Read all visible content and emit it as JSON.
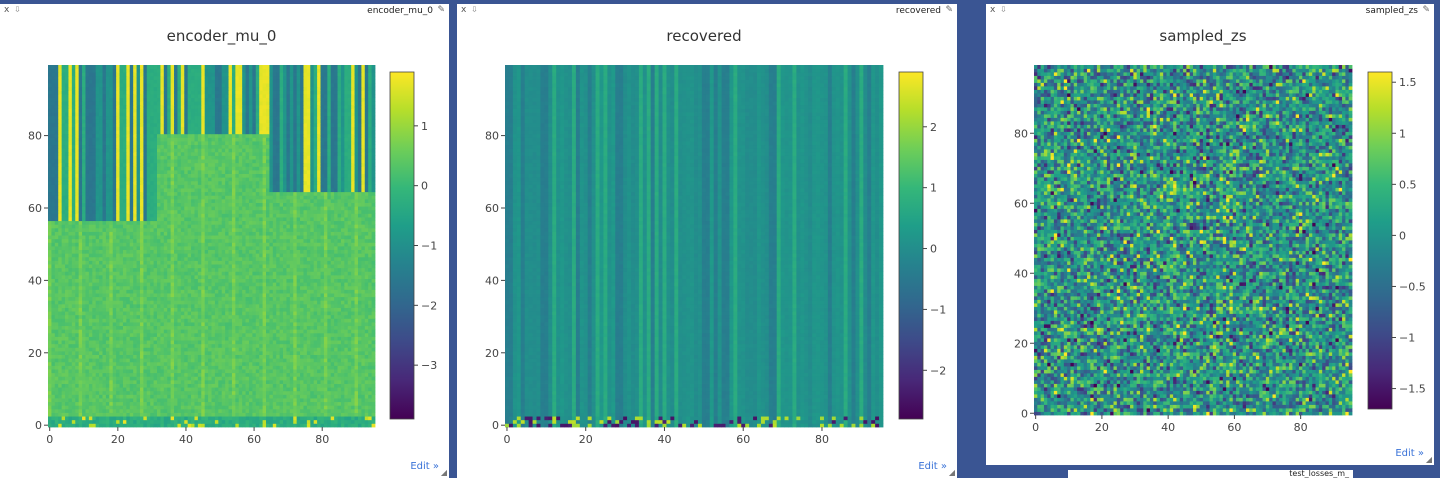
{
  "panes": [
    {
      "label": "encoder_mu_0",
      "close": "x",
      "edit": "Edit »",
      "chart_data": {
        "type": "heatmap",
        "title": "encoder_mu_0",
        "x_range": [
          0,
          95
        ],
        "y_range": [
          0,
          99
        ],
        "x_ticks": [
          "0",
          "20",
          "40",
          "60",
          "80"
        ],
        "y_ticks": [
          "0",
          "20",
          "40",
          "60",
          "80"
        ],
        "colorscale": "viridis",
        "zmin": -3.9,
        "zmax": 1.9,
        "colorbar_ticks": [
          "1",
          "0",
          "−1",
          "−2",
          "−3"
        ],
        "colorbar_tick_values": [
          1,
          0,
          -1,
          -2,
          -3
        ],
        "pattern": "encoder"
      }
    },
    {
      "label": "recovered",
      "close": "x",
      "edit": "Edit »",
      "chart_data": {
        "type": "heatmap",
        "title": "recovered",
        "x_range": [
          0,
          95
        ],
        "y_range": [
          0,
          99
        ],
        "x_ticks": [
          "0",
          "20",
          "40",
          "60",
          "80"
        ],
        "y_ticks": [
          "0",
          "20",
          "40",
          "60",
          "80"
        ],
        "colorscale": "viridis",
        "zmin": -2.8,
        "zmax": 2.9,
        "colorbar_ticks": [
          "2",
          "1",
          "0",
          "−1",
          "−2"
        ],
        "colorbar_tick_values": [
          2,
          1,
          0,
          -1,
          -2
        ],
        "pattern": "recovered"
      }
    },
    {
      "label": "sampled_zs",
      "close": "x",
      "edit": "Edit »",
      "chart_data": {
        "type": "heatmap",
        "title": "sampled_zs",
        "x_range": [
          0,
          95
        ],
        "y_range": [
          0,
          99
        ],
        "x_ticks": [
          "0",
          "20",
          "40",
          "60",
          "80"
        ],
        "y_ticks": [
          "0",
          "20",
          "40",
          "60",
          "80"
        ],
        "colorscale": "viridis",
        "zmin": -1.7,
        "zmax": 1.6,
        "colorbar_ticks": [
          "1.5",
          "1",
          "0.5",
          "0",
          "−0.5",
          "−1",
          "−1.5"
        ],
        "colorbar_tick_values": [
          1.5,
          1,
          0.5,
          0,
          -0.5,
          -1,
          -1.5
        ],
        "pattern": "random"
      }
    }
  ],
  "strip": {
    "label": "test_losses_m_"
  }
}
